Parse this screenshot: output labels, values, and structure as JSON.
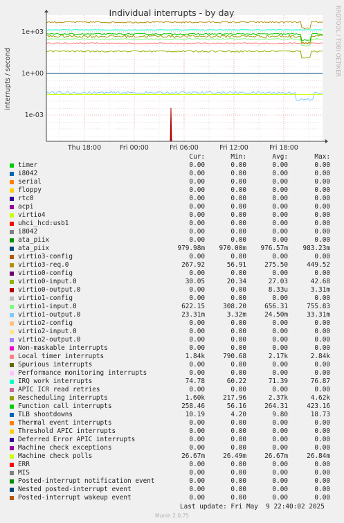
{
  "chart_data": {
    "type": "line",
    "title": "Individual interrupts - by day",
    "ylabel": "interrupts / second",
    "y_scale": "log",
    "y_ticks": [
      "1e+03",
      "1e+00",
      "1e-03"
    ],
    "x_ticks": [
      "Thu 18:00",
      "Fri 00:00",
      "Fri 06:00",
      "Fri 12:00",
      "Fri 18:00"
    ],
    "grid": true,
    "series_levels": {
      "virtio3-req.0": 5000,
      "IRQ work interrupts": 1400,
      "Function call interrupts": 700,
      "Rescheduling interrupts": 480,
      "virtio1-input.0": 300,
      "Local timer interrupts": 150,
      "virtio0-input.0": 40,
      "virtio1-output.0": 0.04,
      "Machine check polls": 0.03,
      "ata_piix": 1
    },
    "spike": {
      "series": "virtio0-output.0",
      "x": "Fri 05:45",
      "peak": 0.00331
    }
  },
  "legend": {
    "headers": [
      "Cur:",
      "Min:",
      "Avg:",
      "Max:"
    ],
    "rows": [
      {
        "name": "timer",
        "color": "#00cc00",
        "cur": "0.00",
        "min": "0.00",
        "avg": "0.00",
        "max": "0.00"
      },
      {
        "name": "i8042",
        "color": "#0066b3",
        "cur": "0.00",
        "min": "0.00",
        "avg": "0.00",
        "max": "0.00"
      },
      {
        "name": "serial",
        "color": "#ff8000",
        "cur": "0.00",
        "min": "0.00",
        "avg": "0.00",
        "max": "0.00"
      },
      {
        "name": "floppy",
        "color": "#ffcc00",
        "cur": "0.00",
        "min": "0.00",
        "avg": "0.00",
        "max": "0.00"
      },
      {
        "name": "rtc0",
        "color": "#330099",
        "cur": "0.00",
        "min": "0.00",
        "avg": "0.00",
        "max": "0.00"
      },
      {
        "name": "acpi",
        "color": "#990099",
        "cur": "0.00",
        "min": "0.00",
        "avg": "0.00",
        "max": "0.00"
      },
      {
        "name": "virtio4",
        "color": "#ccff00",
        "cur": "0.00",
        "min": "0.00",
        "avg": "0.00",
        "max": "0.00"
      },
      {
        "name": "uhci_hcd:usb1",
        "color": "#ff0000",
        "cur": "0.00",
        "min": "0.00",
        "avg": "0.00",
        "max": "0.00"
      },
      {
        "name": "i8042",
        "color": "#808080",
        "cur": "0.00",
        "min": "0.00",
        "avg": "0.00",
        "max": "0.00"
      },
      {
        "name": "ata_piix",
        "color": "#008f00",
        "cur": "0.00",
        "min": "0.00",
        "avg": "0.00",
        "max": "0.00"
      },
      {
        "name": "ata_piix",
        "color": "#00487d",
        "cur": "979.98m",
        "min": "970.00m",
        "avg": "976.57m",
        "max": "983.23m"
      },
      {
        "name": "virtio3-config",
        "color": "#b35a00",
        "cur": "0.00",
        "min": "0.00",
        "avg": "0.00",
        "max": "0.00"
      },
      {
        "name": "virtio3-req.0",
        "color": "#b38f00",
        "cur": "267.92",
        "min": "56.91",
        "avg": "275.50",
        "max": "449.52"
      },
      {
        "name": "virtio0-config",
        "color": "#6b006b",
        "cur": "0.00",
        "min": "0.00",
        "avg": "0.00",
        "max": "0.00"
      },
      {
        "name": "virtio0-input.0",
        "color": "#8fb300",
        "cur": "30.05",
        "min": "20.34",
        "avg": "27.03",
        "max": "42.68"
      },
      {
        "name": "virtio0-output.0",
        "color": "#b30000",
        "cur": "0.00",
        "min": "0.00",
        "avg": "8.33u",
        "max": "3.31m"
      },
      {
        "name": "virtio1-config",
        "color": "#bebebe",
        "cur": "0.00",
        "min": "0.00",
        "avg": "0.00",
        "max": "0.00"
      },
      {
        "name": "virtio1-input.0",
        "color": "#80ff80",
        "cur": "622.15",
        "min": "308.20",
        "avg": "656.31",
        "max": "755.83"
      },
      {
        "name": "virtio1-output.0",
        "color": "#80c9ff",
        "cur": "23.31m",
        "min": "3.32m",
        "avg": "24.50m",
        "max": "33.31m"
      },
      {
        "name": "virtio2-config",
        "color": "#ffc080",
        "cur": "0.00",
        "min": "0.00",
        "avg": "0.00",
        "max": "0.00"
      },
      {
        "name": "virtio2-input.0",
        "color": "#ffe680",
        "cur": "0.00",
        "min": "0.00",
        "avg": "0.00",
        "max": "0.00"
      },
      {
        "name": "virtio2-output.0",
        "color": "#aa80ff",
        "cur": "0.00",
        "min": "0.00",
        "avg": "0.00",
        "max": "0.00"
      },
      {
        "name": "Non-maskable interrupts",
        "color": "#ee00cc",
        "cur": "0.00",
        "min": "0.00",
        "avg": "0.00",
        "max": "0.00"
      },
      {
        "name": "Local timer interrupts",
        "color": "#ff8080",
        "cur": "1.84k",
        "min": "790.68",
        "avg": "2.17k",
        "max": "2.84k"
      },
      {
        "name": "Spurious interrupts",
        "color": "#666600",
        "cur": "0.00",
        "min": "0.00",
        "avg": "0.00",
        "max": "0.00"
      },
      {
        "name": "Performance monitoring interrupts",
        "color": "#ffbfff",
        "cur": "0.00",
        "min": "0.00",
        "avg": "0.00",
        "max": "0.00"
      },
      {
        "name": "IRQ work interrupts",
        "color": "#00ffcc",
        "cur": "74.78",
        "min": "60.22",
        "avg": "71.39",
        "max": "76.87"
      },
      {
        "name": "APIC ICR read retries",
        "color": "#cc6699",
        "cur": "0.00",
        "min": "0.00",
        "avg": "0.00",
        "max": "0.00"
      },
      {
        "name": "Rescheduling interrupts",
        "color": "#999900",
        "cur": "1.60k",
        "min": "217.96",
        "avg": "2.37k",
        "max": "4.62k"
      },
      {
        "name": "Function call interrupts",
        "color": "#00cc00",
        "cur": "258.46",
        "min": "56.16",
        "avg": "264.31",
        "max": "423.16"
      },
      {
        "name": "TLB shootdowns",
        "color": "#0066b3",
        "cur": "10.19",
        "min": "4.20",
        "avg": "9.80",
        "max": "18.73"
      },
      {
        "name": "Thermal event interrupts",
        "color": "#ff8000",
        "cur": "0.00",
        "min": "0.00",
        "avg": "0.00",
        "max": "0.00"
      },
      {
        "name": "Threshold APIC interrupts",
        "color": "#ffcc00",
        "cur": "0.00",
        "min": "0.00",
        "avg": "0.00",
        "max": "0.00"
      },
      {
        "name": "Deferred Error APIC interrupts",
        "color": "#330099",
        "cur": "0.00",
        "min": "0.00",
        "avg": "0.00",
        "max": "0.00"
      },
      {
        "name": "Machine check exceptions",
        "color": "#990099",
        "cur": "0.00",
        "min": "0.00",
        "avg": "0.00",
        "max": "0.00"
      },
      {
        "name": "Machine check polls",
        "color": "#ccff00",
        "cur": "26.67m",
        "min": "26.49m",
        "avg": "26.67m",
        "max": "26.84m"
      },
      {
        "name": "ERR",
        "color": "#ff0000",
        "cur": "0.00",
        "min": "0.00",
        "avg": "0.00",
        "max": "0.00"
      },
      {
        "name": "MIS",
        "color": "#808080",
        "cur": "0.00",
        "min": "0.00",
        "avg": "0.00",
        "max": "0.00"
      },
      {
        "name": "Posted-interrupt notification event",
        "color": "#008f00",
        "cur": "0.00",
        "min": "0.00",
        "avg": "0.00",
        "max": "0.00"
      },
      {
        "name": "Nested posted-interrupt event",
        "color": "#00487d",
        "cur": "0.00",
        "min": "0.00",
        "avg": "0.00",
        "max": "0.00"
      },
      {
        "name": "Posted-interrupt wakeup event",
        "color": "#b35a00",
        "cur": "0.00",
        "min": "0.00",
        "avg": "0.00",
        "max": "0.00"
      }
    ]
  },
  "last_update": "Last update: Fri May  9 22:40:02 2025",
  "side_text": "RRDTOOL / TOBI OETIKER",
  "version": "Munin 2.0.75"
}
